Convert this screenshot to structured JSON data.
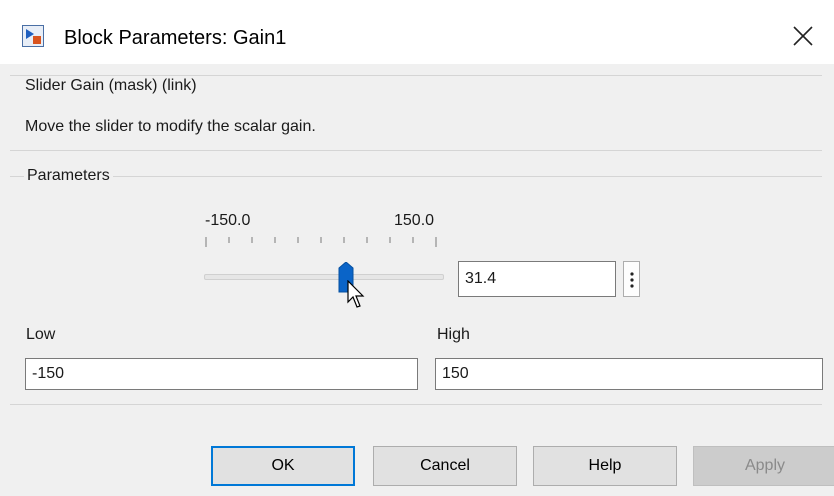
{
  "window": {
    "title": "Block Parameters: Gain1",
    "icon": "simulink-block-icon",
    "close_icon": "close-icon"
  },
  "mask_group": {
    "label": "Slider Gain (mask) (link)",
    "description": "Move the slider to modify the scalar gain."
  },
  "parameters": {
    "label": "Parameters",
    "slider": {
      "min_label": "-150.0",
      "max_label": "150.0",
      "min": -150,
      "max": 150,
      "value": 31.4,
      "value_text": "31.4",
      "tick_count": 11
    },
    "low": {
      "label": "Low",
      "value": "-150"
    },
    "high": {
      "label": "High",
      "value": "150"
    }
  },
  "buttons": {
    "ok": "OK",
    "cancel": "Cancel",
    "help": "Help",
    "apply": "Apply"
  },
  "colors": {
    "accent": "#0078d7",
    "thumb": "#0a64c8",
    "window_bg": "#f0f0f0"
  }
}
